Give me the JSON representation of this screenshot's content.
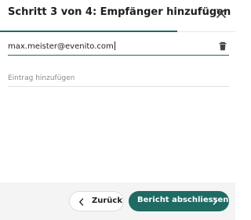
{
  "dialog": {
    "title": "Schritt 3 von 4: Empfänger hinzufügen",
    "close_icon": "close-icon",
    "step_current": 3,
    "step_total": 4
  },
  "recipients": [
    {
      "value": "max.meister@evenito.com",
      "action_icon": "trash-icon"
    }
  ],
  "add_entry": {
    "placeholder": "Eintrag hinzufügen",
    "value": ""
  },
  "footer": {
    "back_label": "Zurück",
    "back_icon": "chevron-left-icon",
    "finish_label": "Bericht abschliessen",
    "finish_icon": "chevron-right-icon"
  },
  "colors": {
    "accent": "#1f6b63",
    "footer_bg": "#f4f4f4",
    "text": "#1e1e1e"
  }
}
